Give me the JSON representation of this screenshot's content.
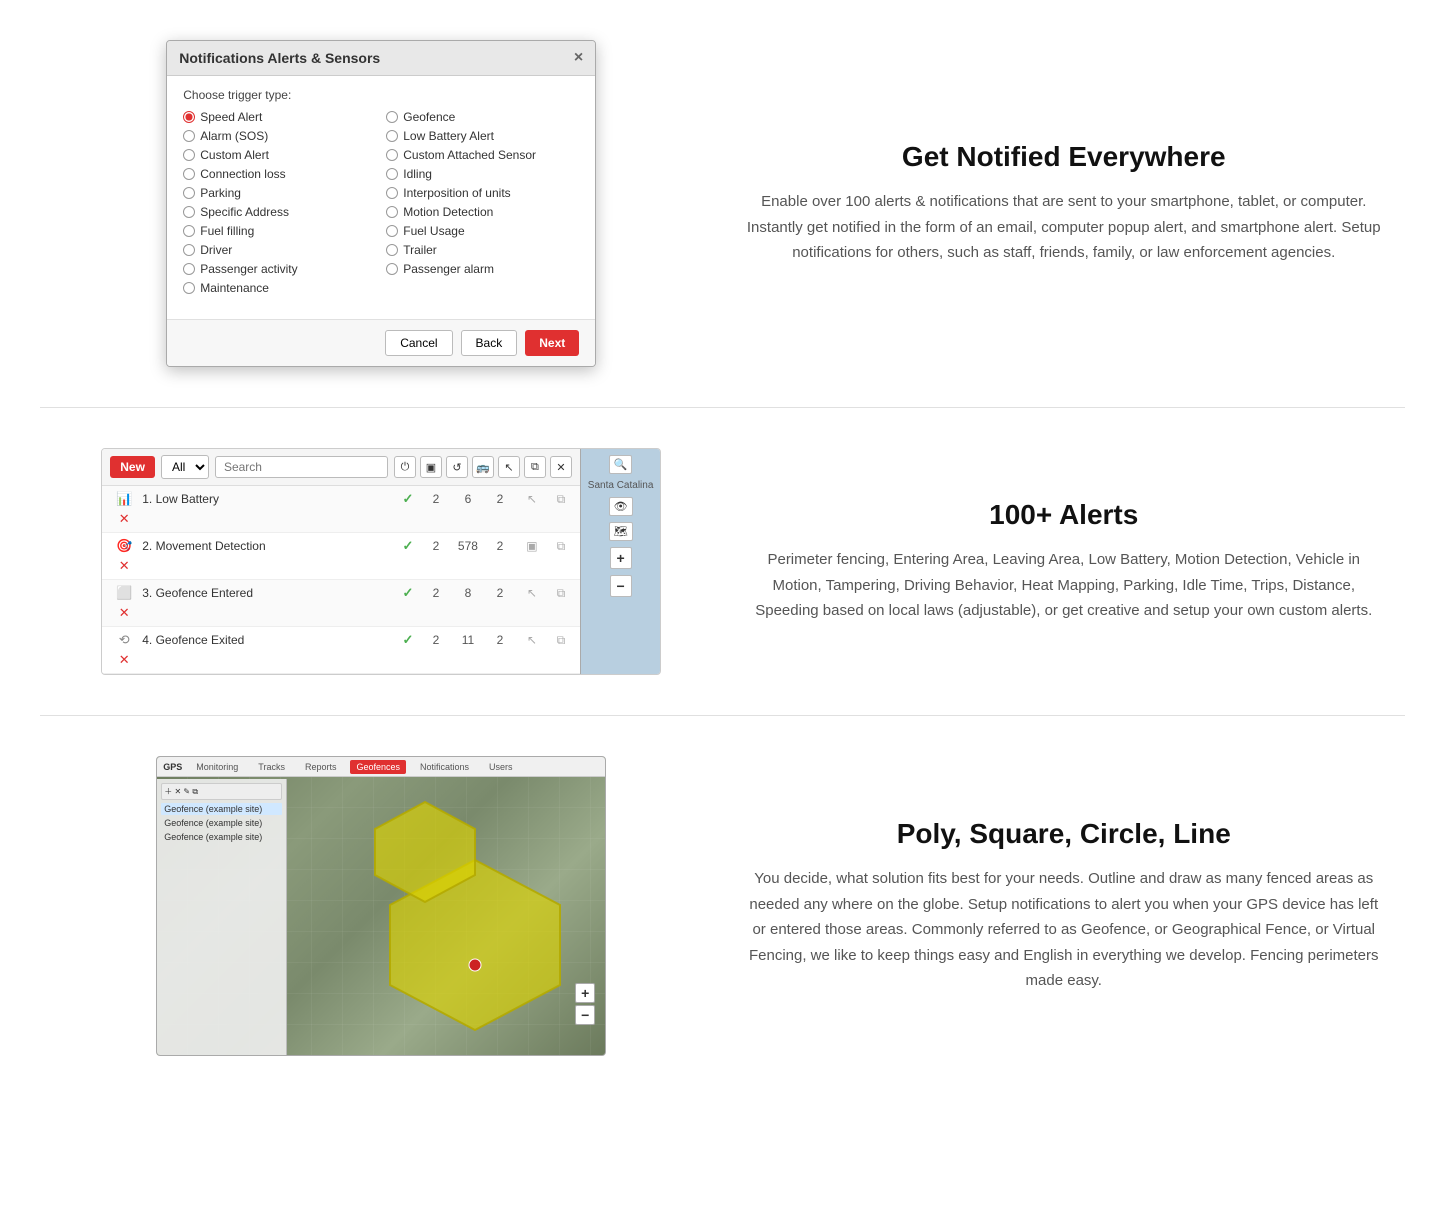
{
  "section1": {
    "title": "Get Notified Everywhere",
    "description": "Enable over 100 alerts & notifications that are sent to your smartphone, tablet, or computer. Instantly get notified in the form of an email, computer popup alert, and smartphone alert. Setup notifications for others, such as staff, friends, family, or law enforcement agencies."
  },
  "modal": {
    "title": "Notifications Alerts & Sensors",
    "close_label": "×",
    "trigger_label": "Choose trigger type:",
    "triggers_left": [
      {
        "label": "Speed Alert",
        "selected": true
      },
      {
        "label": "Alarm (SOS)",
        "selected": false
      },
      {
        "label": "Custom Alert",
        "selected": false
      },
      {
        "label": "Connection loss",
        "selected": false
      },
      {
        "label": "Parking",
        "selected": false
      },
      {
        "label": "Specific Address",
        "selected": false
      },
      {
        "label": "Fuel filling",
        "selected": false
      },
      {
        "label": "Driver",
        "selected": false
      },
      {
        "label": "Passenger activity",
        "selected": false
      },
      {
        "label": "Maintenance",
        "selected": false
      }
    ],
    "triggers_right": [
      {
        "label": "Geofence",
        "selected": false
      },
      {
        "label": "Low Battery Alert",
        "selected": false
      },
      {
        "label": "Custom Attached Sensor",
        "selected": false
      },
      {
        "label": "Idling",
        "selected": false
      },
      {
        "label": "Interposition of units",
        "selected": false
      },
      {
        "label": "Motion Detection",
        "selected": false
      },
      {
        "label": "Fuel Usage",
        "selected": false
      },
      {
        "label": "Trailer",
        "selected": false
      },
      {
        "label": "Passenger alarm",
        "selected": false
      }
    ],
    "cancel_label": "Cancel",
    "back_label": "Back",
    "next_label": "Next"
  },
  "section2": {
    "title": "100+ Alerts",
    "description": "Perimeter fencing, Entering Area, Leaving Area, Low Battery, Motion Detection, Vehicle in Motion, Tampering, Driving Behavior, Heat Mapping, Parking, Idle Time, Trips, Distance, Speeding based on local laws (adjustable), or get creative and setup your own custom alerts."
  },
  "alerts_panel": {
    "new_label": "New",
    "filter_options": [
      "All"
    ],
    "search_placeholder": "Search",
    "rows": [
      {
        "icon": "bar-icon",
        "name": "1. Low Battery",
        "check": true,
        "num1": 2,
        "num2": 6,
        "num3": 2
      },
      {
        "icon": "circle-icon",
        "name": "2. Movement Detection",
        "check": true,
        "num1": 2,
        "num2": 578,
        "num3": 2
      },
      {
        "icon": "square-icon",
        "name": "3. Geofence Entered",
        "check": true,
        "num1": 2,
        "num2": 8,
        "num3": 2
      },
      {
        "icon": "fence-icon",
        "name": "4. Geofence Exited",
        "check": true,
        "num1": 2,
        "num2": 11,
        "num3": 2
      }
    ]
  },
  "section3": {
    "title": "Poly, Square, Circle, Line",
    "description": "You decide, what solution fits best for your needs. Outline and draw as many fenced areas as needed any where on the globe. Setup notifications to alert you when your GPS device has left or entered those areas. Commonly referred to as Geofence, or Geographical Fence, or Virtual Fencing, we like to keep things easy and English in everything we develop. Fencing perimeters made easy."
  },
  "geo_nav": {
    "items": [
      "Monitoring",
      "Tracks",
      "Reports",
      "Geofences",
      "Notifications",
      "Users"
    ],
    "active": "Geofences"
  }
}
